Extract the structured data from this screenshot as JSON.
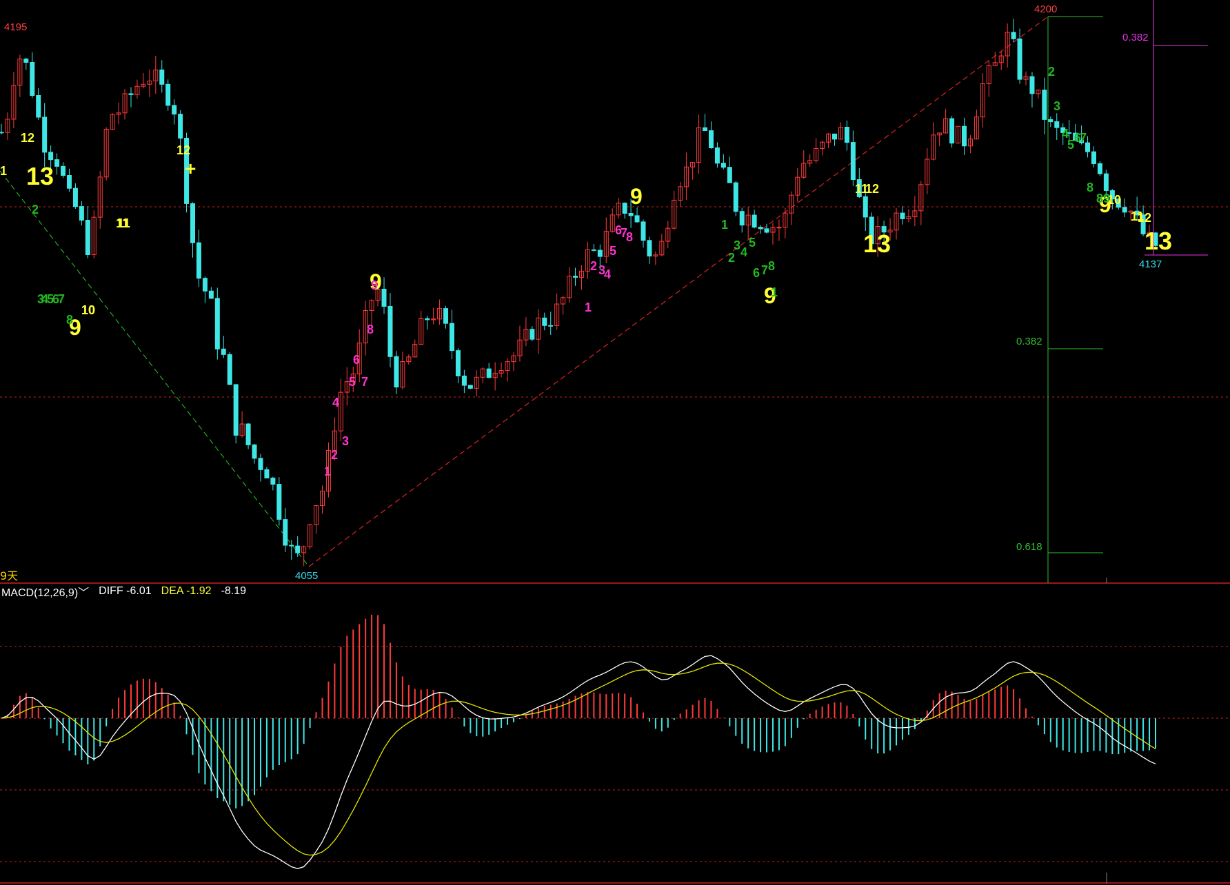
{
  "price_panel": {
    "high_label": "4195",
    "peak_label": "4200",
    "low_label": "4055",
    "last_low_label": "4137",
    "fib_top_label": "0.382",
    "fib_mid_label": "0.382",
    "fib_low_label": "0.618",
    "period_label": "9天"
  },
  "macd_panel": {
    "title": "MACD(12,26,9)",
    "dropdown_glyph": "﹀",
    "diff_label": "DIFF -6.01",
    "dea_label": "DEA -1.92",
    "hist_label": "-8.19"
  },
  "colors": {
    "background": "#000000",
    "up_candle": "#ff3b3b",
    "down_candle": "#3ee6e6",
    "diff_line": "#ffffff",
    "dea_line": "#e6e600",
    "fib_green": "#2fbf2f",
    "fib_magenta": "#e633e6",
    "grid_red": "#cc2020",
    "count_yellow": "#ffff33",
    "count_green": "#22b822",
    "count_magenta": "#ff33cc"
  },
  "chart_data": {
    "type": "candlestick",
    "price_range": [
      4050,
      4203
    ],
    "annotations": {
      "price_labels": [
        "4195",
        "4200",
        "4055",
        "4137"
      ],
      "td_counts_yellow": [
        "12",
        "13",
        "9",
        "10",
        "11",
        "12",
        "+",
        "11",
        "9",
        "9",
        "9",
        "11",
        "12",
        "13",
        "9",
        "10",
        "11",
        "12",
        "13",
        "1",
        "10"
      ],
      "td_counts_green": [
        "2",
        "3",
        "4",
        "5",
        "6",
        "7",
        "8",
        "1",
        "2",
        "3",
        "4",
        "5",
        "6",
        "7",
        "8",
        "1",
        "2",
        "3",
        "4",
        "5",
        "6",
        "7",
        "8",
        "8",
        "9"
      ],
      "td_counts_magenta": [
        "1",
        "2",
        "3",
        "4",
        "5",
        "6",
        "7",
        "8",
        "9",
        "1",
        "2",
        "3",
        "4",
        "5",
        "6",
        "7",
        "8"
      ]
    },
    "macd": {
      "params": "12,26,9",
      "diff": -6.01,
      "dea": -1.92,
      "hist": -8.19
    }
  }
}
